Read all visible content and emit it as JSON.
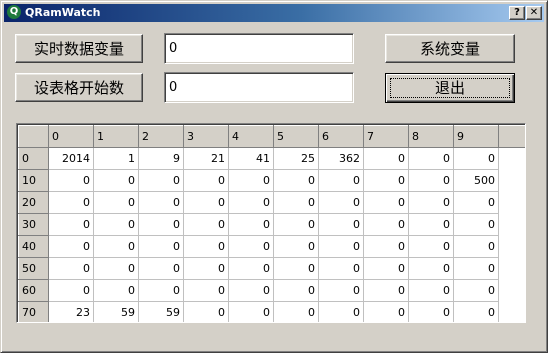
{
  "window": {
    "title": "QRamWatch",
    "app_icon_glyph": "Q",
    "help_label": "?",
    "close_label": "✕",
    "titlebar_colors": [
      "#0a246a",
      "#a6caf0"
    ]
  },
  "controls": {
    "realtime_button_label": "实时数据变量",
    "realtime_value": "0",
    "start_index_button_label": "设表格开始数",
    "start_index_value": "0",
    "system_vars_button_label": "系统变量",
    "exit_button_label": "退出"
  },
  "grid": {
    "column_headers": [
      "0",
      "1",
      "2",
      "3",
      "4",
      "5",
      "6",
      "7",
      "8",
      "9"
    ],
    "rows": [
      {
        "header": "0",
        "cells": [
          "2014",
          "1",
          "9",
          "21",
          "41",
          "25",
          "362",
          "0",
          "0",
          "0"
        ]
      },
      {
        "header": "10",
        "cells": [
          "0",
          "0",
          "0",
          "0",
          "0",
          "0",
          "0",
          "0",
          "0",
          "500"
        ]
      },
      {
        "header": "20",
        "cells": [
          "0",
          "0",
          "0",
          "0",
          "0",
          "0",
          "0",
          "0",
          "0",
          "0"
        ]
      },
      {
        "header": "30",
        "cells": [
          "0",
          "0",
          "0",
          "0",
          "0",
          "0",
          "0",
          "0",
          "0",
          "0"
        ]
      },
      {
        "header": "40",
        "cells": [
          "0",
          "0",
          "0",
          "0",
          "0",
          "0",
          "0",
          "0",
          "0",
          "0"
        ]
      },
      {
        "header": "50",
        "cells": [
          "0",
          "0",
          "0",
          "0",
          "0",
          "0",
          "0",
          "0",
          "0",
          "0"
        ]
      },
      {
        "header": "60",
        "cells": [
          "0",
          "0",
          "0",
          "0",
          "0",
          "0",
          "0",
          "0",
          "0",
          "0"
        ]
      },
      {
        "header": "70",
        "cells": [
          "23",
          "59",
          "59",
          "0",
          "0",
          "0",
          "0",
          "0",
          "0",
          "0"
        ]
      }
    ]
  }
}
